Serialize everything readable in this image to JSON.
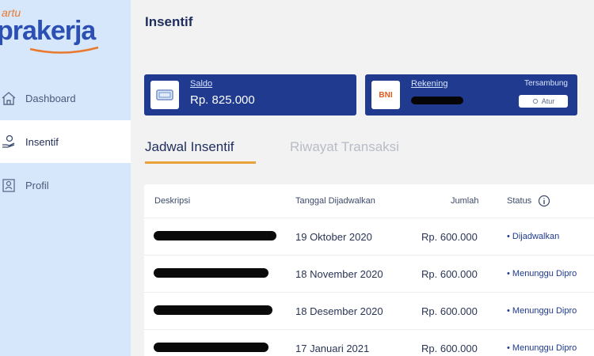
{
  "brand": {
    "small_text": "artu",
    "main_text": "prakerja",
    "accent_color": "#e9792f",
    "brand_color": "#2b4fb3"
  },
  "sidebar": {
    "items": [
      {
        "label": "Dashboard",
        "icon": "house-icon",
        "active": false
      },
      {
        "label": "Insentif",
        "icon": "hand-coin-icon",
        "active": true
      },
      {
        "label": "Profil",
        "icon": "profile-card-icon",
        "active": false
      }
    ]
  },
  "header": {
    "title": "Insentif"
  },
  "cards": {
    "saldo": {
      "label": "Saldo",
      "value": "Rp. 825.000",
      "icon": "wallet-icon"
    },
    "rekening": {
      "label": "Rekening",
      "bank": "BNI",
      "status": "Tersambung",
      "action": "Atur",
      "icon": "bank-logo-icon"
    }
  },
  "tabs": [
    {
      "label": "Jadwal Insentif",
      "active": true
    },
    {
      "label": "Riwayat Transaksi",
      "active": false
    }
  ],
  "table": {
    "headers": {
      "deskripsi": "Deskripsi",
      "tanggal": "Tanggal Dijadwalkan",
      "jumlah": "Jumlah",
      "status": "Status"
    },
    "rows": [
      {
        "tanggal": "19 Oktober 2020",
        "jumlah": "Rp. 600.000",
        "status": "• Dijadwalkan"
      },
      {
        "tanggal": "18 November 2020",
        "jumlah": "Rp. 600.000",
        "status": "• Menunggu Dipro"
      },
      {
        "tanggal": "18 Desember 2020",
        "jumlah": "Rp. 600.000",
        "status": "• Menunggu Dipro"
      },
      {
        "tanggal": "17 Januari 2021",
        "jumlah": "Rp. 600.000",
        "status": "• Menunggu Dipro"
      }
    ]
  },
  "colors": {
    "primary": "#1f3a8f",
    "sidebar_bg": "#d6e6fb",
    "tab_accent": "#e9a237"
  }
}
